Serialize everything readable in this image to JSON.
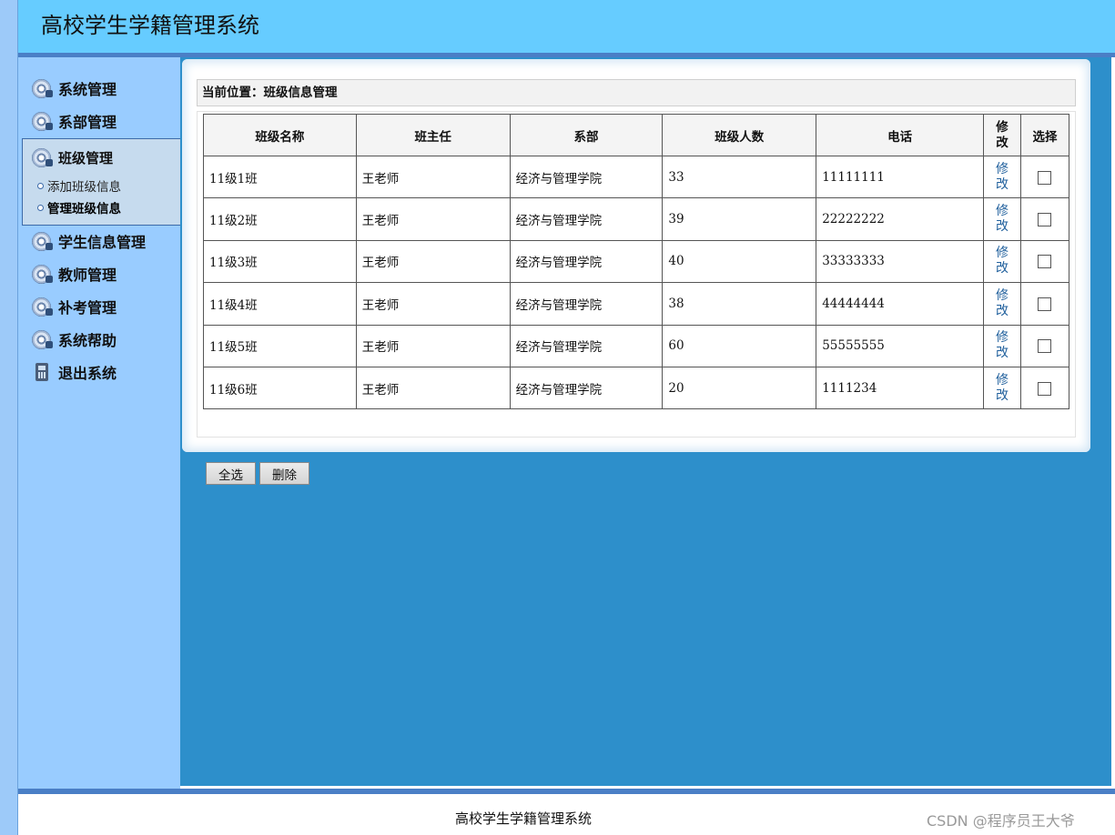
{
  "header": {
    "title": "高校学生学籍管理系统"
  },
  "sidebar": {
    "items": [
      {
        "label": "系统管理",
        "icon": "disc-icon"
      },
      {
        "label": "系部管理",
        "icon": "disc-icon"
      },
      {
        "label": "班级管理",
        "icon": "disc-icon",
        "active": true,
        "subitems": [
          {
            "label": "添加班级信息"
          },
          {
            "label": "管理班级信息",
            "current": true
          }
        ]
      },
      {
        "label": "学生信息管理",
        "icon": "disc-icon"
      },
      {
        "label": "教师管理",
        "icon": "disc-icon"
      },
      {
        "label": "补考管理",
        "icon": "disc-icon"
      },
      {
        "label": "系统帮助",
        "icon": "disc-icon"
      },
      {
        "label": "退出系统",
        "icon": "phone-icon"
      }
    ]
  },
  "main": {
    "breadcrumb": "当前位置：班级信息管理",
    "table": {
      "columns": [
        "班级名称",
        "班主任",
        "系部",
        "班级人数",
        "电话",
        "修改",
        "选择"
      ],
      "rows": [
        {
          "name": "11级1班",
          "teacher": "王老师",
          "dept": "经济与管理学院",
          "count": "33",
          "phone": "11111111",
          "edit": "修改"
        },
        {
          "name": "11级2班",
          "teacher": "王老师",
          "dept": "经济与管理学院",
          "count": "39",
          "phone": "22222222",
          "edit": "修改"
        },
        {
          "name": "11级3班",
          "teacher": "王老师",
          "dept": "经济与管理学院",
          "count": "40",
          "phone": "33333333",
          "edit": "修改"
        },
        {
          "name": "11级4班",
          "teacher": "王老师",
          "dept": "经济与管理学院",
          "count": "38",
          "phone": "44444444",
          "edit": "修改"
        },
        {
          "name": "11级5班",
          "teacher": "王老师",
          "dept": "经济与管理学院",
          "count": "60",
          "phone": "55555555",
          "edit": "修改"
        },
        {
          "name": "11级6班",
          "teacher": "王老师",
          "dept": "经济与管理学院",
          "count": "20",
          "phone": "1111234",
          "edit": "修改"
        }
      ]
    },
    "buttons": {
      "select_all": "全选",
      "delete": "删除"
    }
  },
  "footer": {
    "text": "高校学生学籍管理系统",
    "watermark": "CSDN @程序员王大爷"
  },
  "colors": {
    "header_bg": "#66ccff",
    "sidebar_bg": "#99ccff",
    "content_bg": "#2d8fcb",
    "bar_accent": "#4a7fc6",
    "link": "#1f5f9c"
  }
}
